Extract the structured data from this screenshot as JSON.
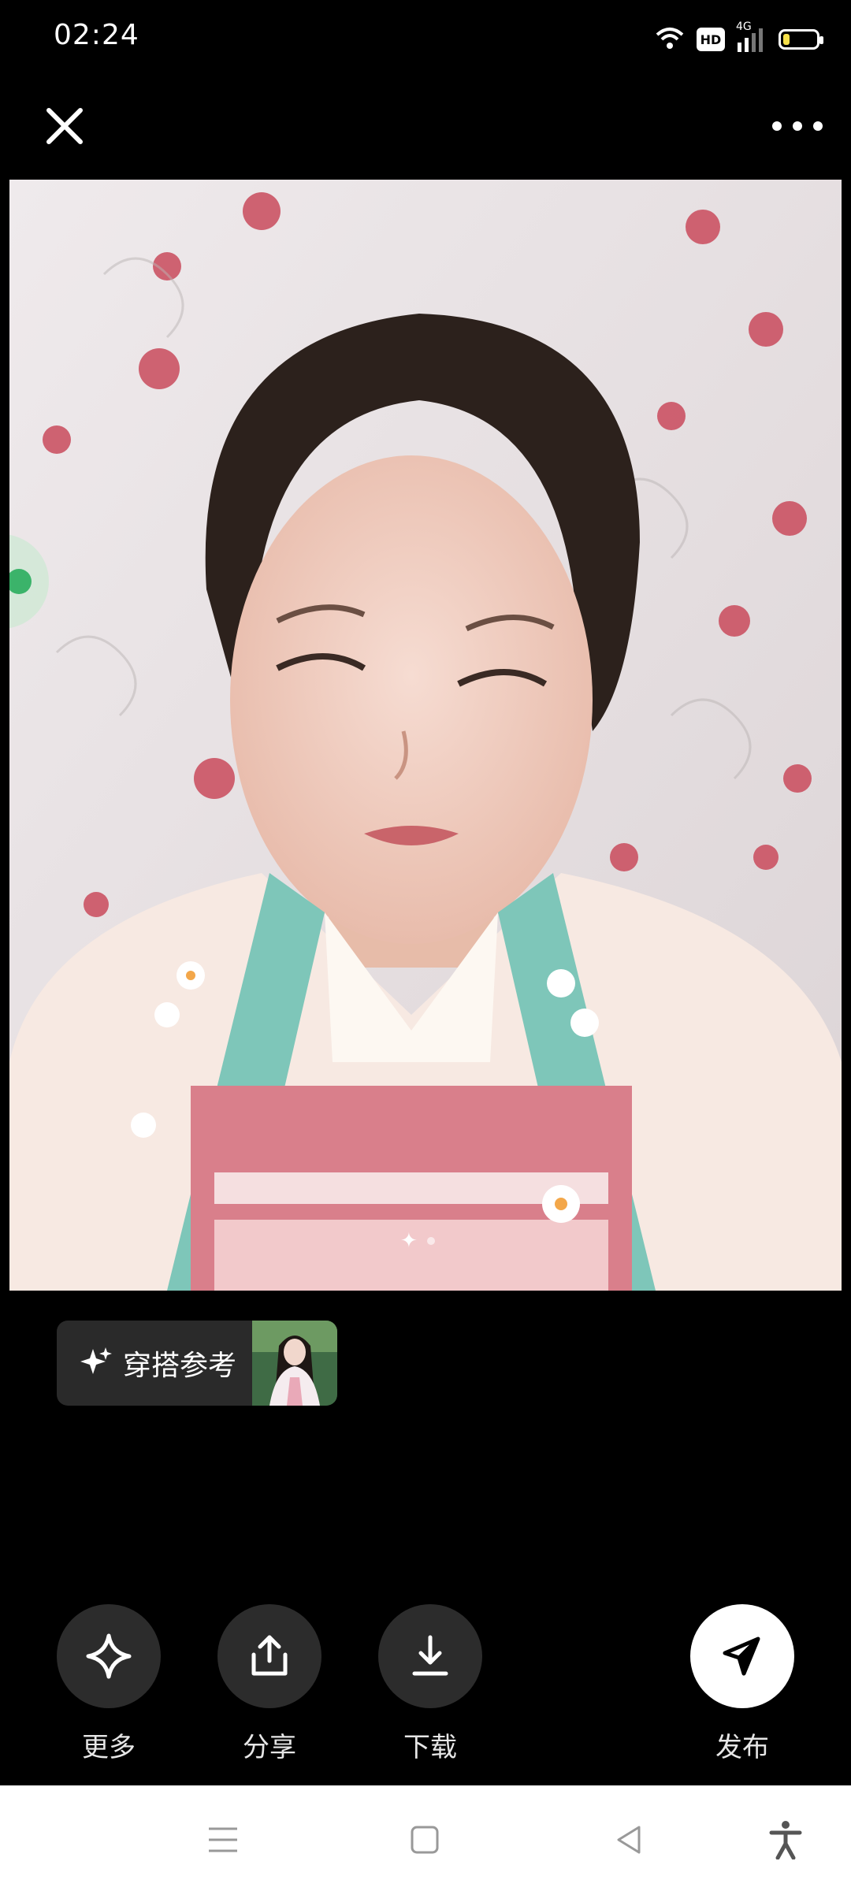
{
  "status_bar": {
    "time": "02:24",
    "network_badge": "HD",
    "network_type": "4G",
    "icons": [
      "wifi-icon",
      "hd-icon",
      "signal-icon",
      "battery-icon"
    ],
    "battery_level": 0.2,
    "battery_color": "#f6e04a"
  },
  "top_bar": {
    "close_icon": "close-icon",
    "more_icon": "more-dots-icon"
  },
  "photo": {
    "compare_icon": "compare-icon",
    "page_indicator_count": 2,
    "page_indicator_active": 0
  },
  "outfit_reference": {
    "icon": "sparkle-icon",
    "label": "穿搭参考"
  },
  "actions": [
    {
      "label": "更多",
      "icon": "sparkle-icon"
    },
    {
      "label": "分享",
      "icon": "share-icon"
    },
    {
      "label": "下载",
      "icon": "download-icon"
    },
    {
      "label": "发布",
      "icon": "send-icon"
    }
  ],
  "nav_bar": {
    "icons": [
      "menu-icon",
      "home-square-icon",
      "back-triangle-icon",
      "accessibility-icon"
    ]
  },
  "colors": {
    "background": "#000000",
    "action_circle": "#2c2c2c",
    "publish_circle": "#ffffff"
  }
}
